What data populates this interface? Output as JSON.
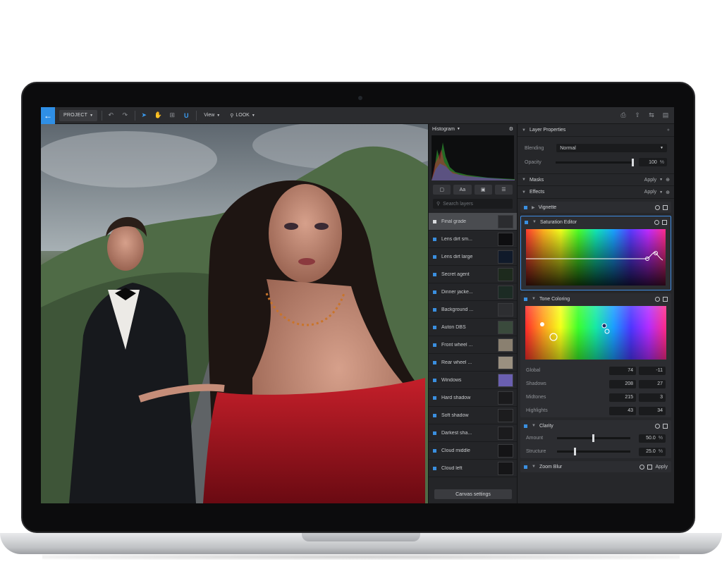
{
  "toolbar": {
    "back_icon": "arrow-left-icon",
    "project_label": "PROJECT",
    "view_label": "View",
    "look_label": "LOOK"
  },
  "histogram": {
    "title": "Histogram"
  },
  "layers": {
    "search_placeholder": "Search layers",
    "tool_text_label": "Aa",
    "items": [
      {
        "name": "Final grade",
        "selected": true
      },
      {
        "name": "Lens dirt sm..."
      },
      {
        "name": "Lens dirt large"
      },
      {
        "name": "Secret agent"
      },
      {
        "name": "Dinner jacke..."
      },
      {
        "name": "Background ..."
      },
      {
        "name": "Auton DBS"
      },
      {
        "name": "Front wheel ..."
      },
      {
        "name": "Rear wheel ..."
      },
      {
        "name": "Windows"
      },
      {
        "name": "Hard shadow"
      },
      {
        "name": "Soft shadow"
      },
      {
        "name": "Darkest sha..."
      },
      {
        "name": "Cloud middle"
      },
      {
        "name": "Cloud left"
      }
    ],
    "canvas_settings_label": "Canvas settings"
  },
  "properties": {
    "title": "Layer Properties",
    "blending_label": "Blending",
    "blending_value": "Normal",
    "opacity_label": "Opacity",
    "opacity_value": "100",
    "opacity_unit": "%",
    "opacity_level": 1.0
  },
  "masks": {
    "title": "Masks",
    "apply_label": "Apply"
  },
  "effects": {
    "title": "Effects",
    "apply_label": "Apply",
    "vignette": {
      "title": "Vignette"
    },
    "saturation": {
      "title": "Saturation Editor"
    },
    "tone": {
      "title": "Tone Coloring",
      "rows": [
        {
          "label": "Global",
          "a": "74",
          "b": "-11"
        },
        {
          "label": "Shadows",
          "a": "208",
          "b": "27"
        },
        {
          "label": "Midtones",
          "a": "215",
          "b": "3"
        },
        {
          "label": "Highlights",
          "a": "43",
          "b": "34"
        }
      ]
    },
    "clarity": {
      "title": "Clarity",
      "amount_label": "Amount",
      "amount_value": "50.0",
      "amount_level": 0.5,
      "structure_label": "Structure",
      "structure_value": "25.0",
      "structure_level": 0.25,
      "unit": "%"
    },
    "zoom_blur": {
      "title": "Zoom Blur",
      "apply_label": "Apply"
    }
  }
}
